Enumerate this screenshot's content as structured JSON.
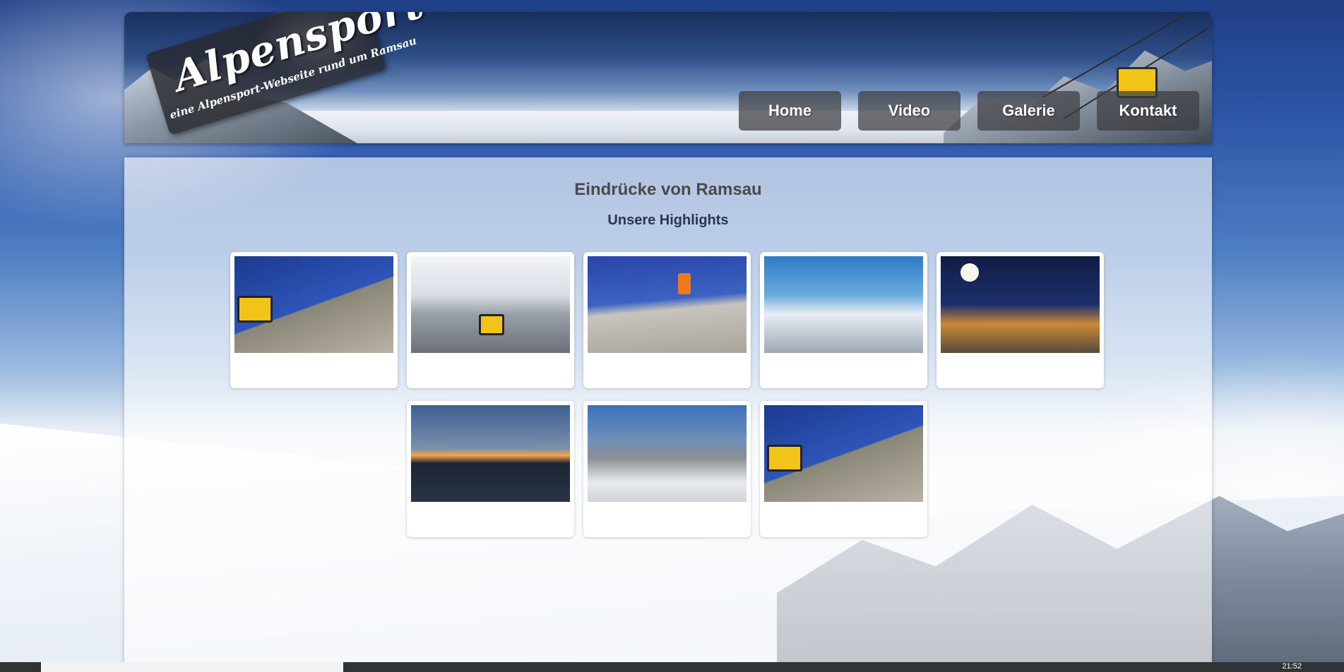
{
  "header": {
    "logo": {
      "title": "Alpensport",
      "subtitle": "eine Alpensport-Webseite rund um Ramsau"
    },
    "nav": [
      {
        "label": "Home"
      },
      {
        "label": "Video"
      },
      {
        "label": "Galerie"
      },
      {
        "label": "Kontakt"
      }
    ]
  },
  "main": {
    "title": "Eindrücke von Ramsau",
    "subtitle": "Unsere Highlights",
    "gallery": [
      {
        "image": "gondola-blue-sky"
      },
      {
        "image": "gondola-fog-mountain"
      },
      {
        "image": "climber-orange"
      },
      {
        "image": "viewing-platform-sea-of-clouds"
      },
      {
        "image": "night-moon-mountain"
      },
      {
        "image": "sunset-mountain"
      },
      {
        "image": "dachstein-peaks"
      },
      {
        "image": "gondola-blue-sky"
      }
    ]
  },
  "taskbar": {
    "clock": "21:52"
  },
  "colors": {
    "nav_bg": "#3c3c40",
    "content_bg": "#ffffff",
    "title": "#4a4a4a",
    "subtitle": "#2a3550"
  }
}
